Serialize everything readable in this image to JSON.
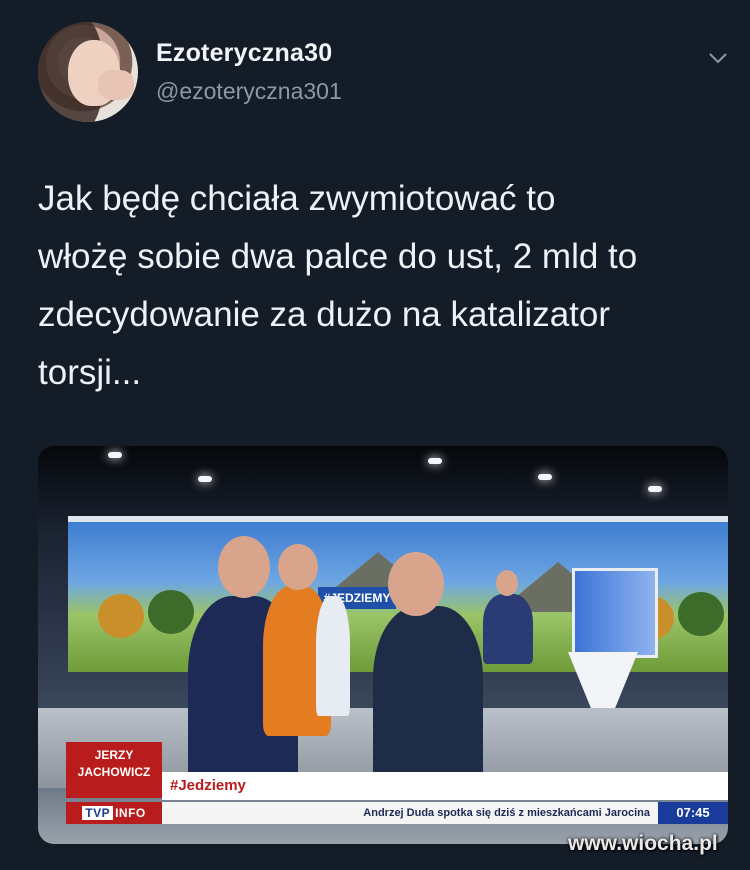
{
  "user": {
    "display_name": "Ezoteryczna30",
    "handle": "@ezoteryczna301"
  },
  "tweet": {
    "text": "Jak będę chciała zwymiotować to\nwłożę sobie dwa palce do ust, 2 mld to\nzdecydowanie za dużo na katalizator\ntorsji..."
  },
  "media": {
    "studio_sign": "#JEDZIEMY",
    "lower_third": {
      "name_line1": "JERZY",
      "name_line2": "JACHOWICZ",
      "title": "#Jedziemy",
      "logo_tvp": "TVP",
      "logo_info": "INFO",
      "ticker": "Andrzej Duda spotka się dziś z mieszkańcami Jarocina",
      "time": "07:45"
    }
  },
  "watermark": "www.wiocha.pl",
  "colors": {
    "background": "#141c28",
    "tvp_red": "#b91c1c",
    "tvp_blue": "#1a3a9c"
  },
  "icons": {
    "menu": "chevron-down-icon"
  }
}
